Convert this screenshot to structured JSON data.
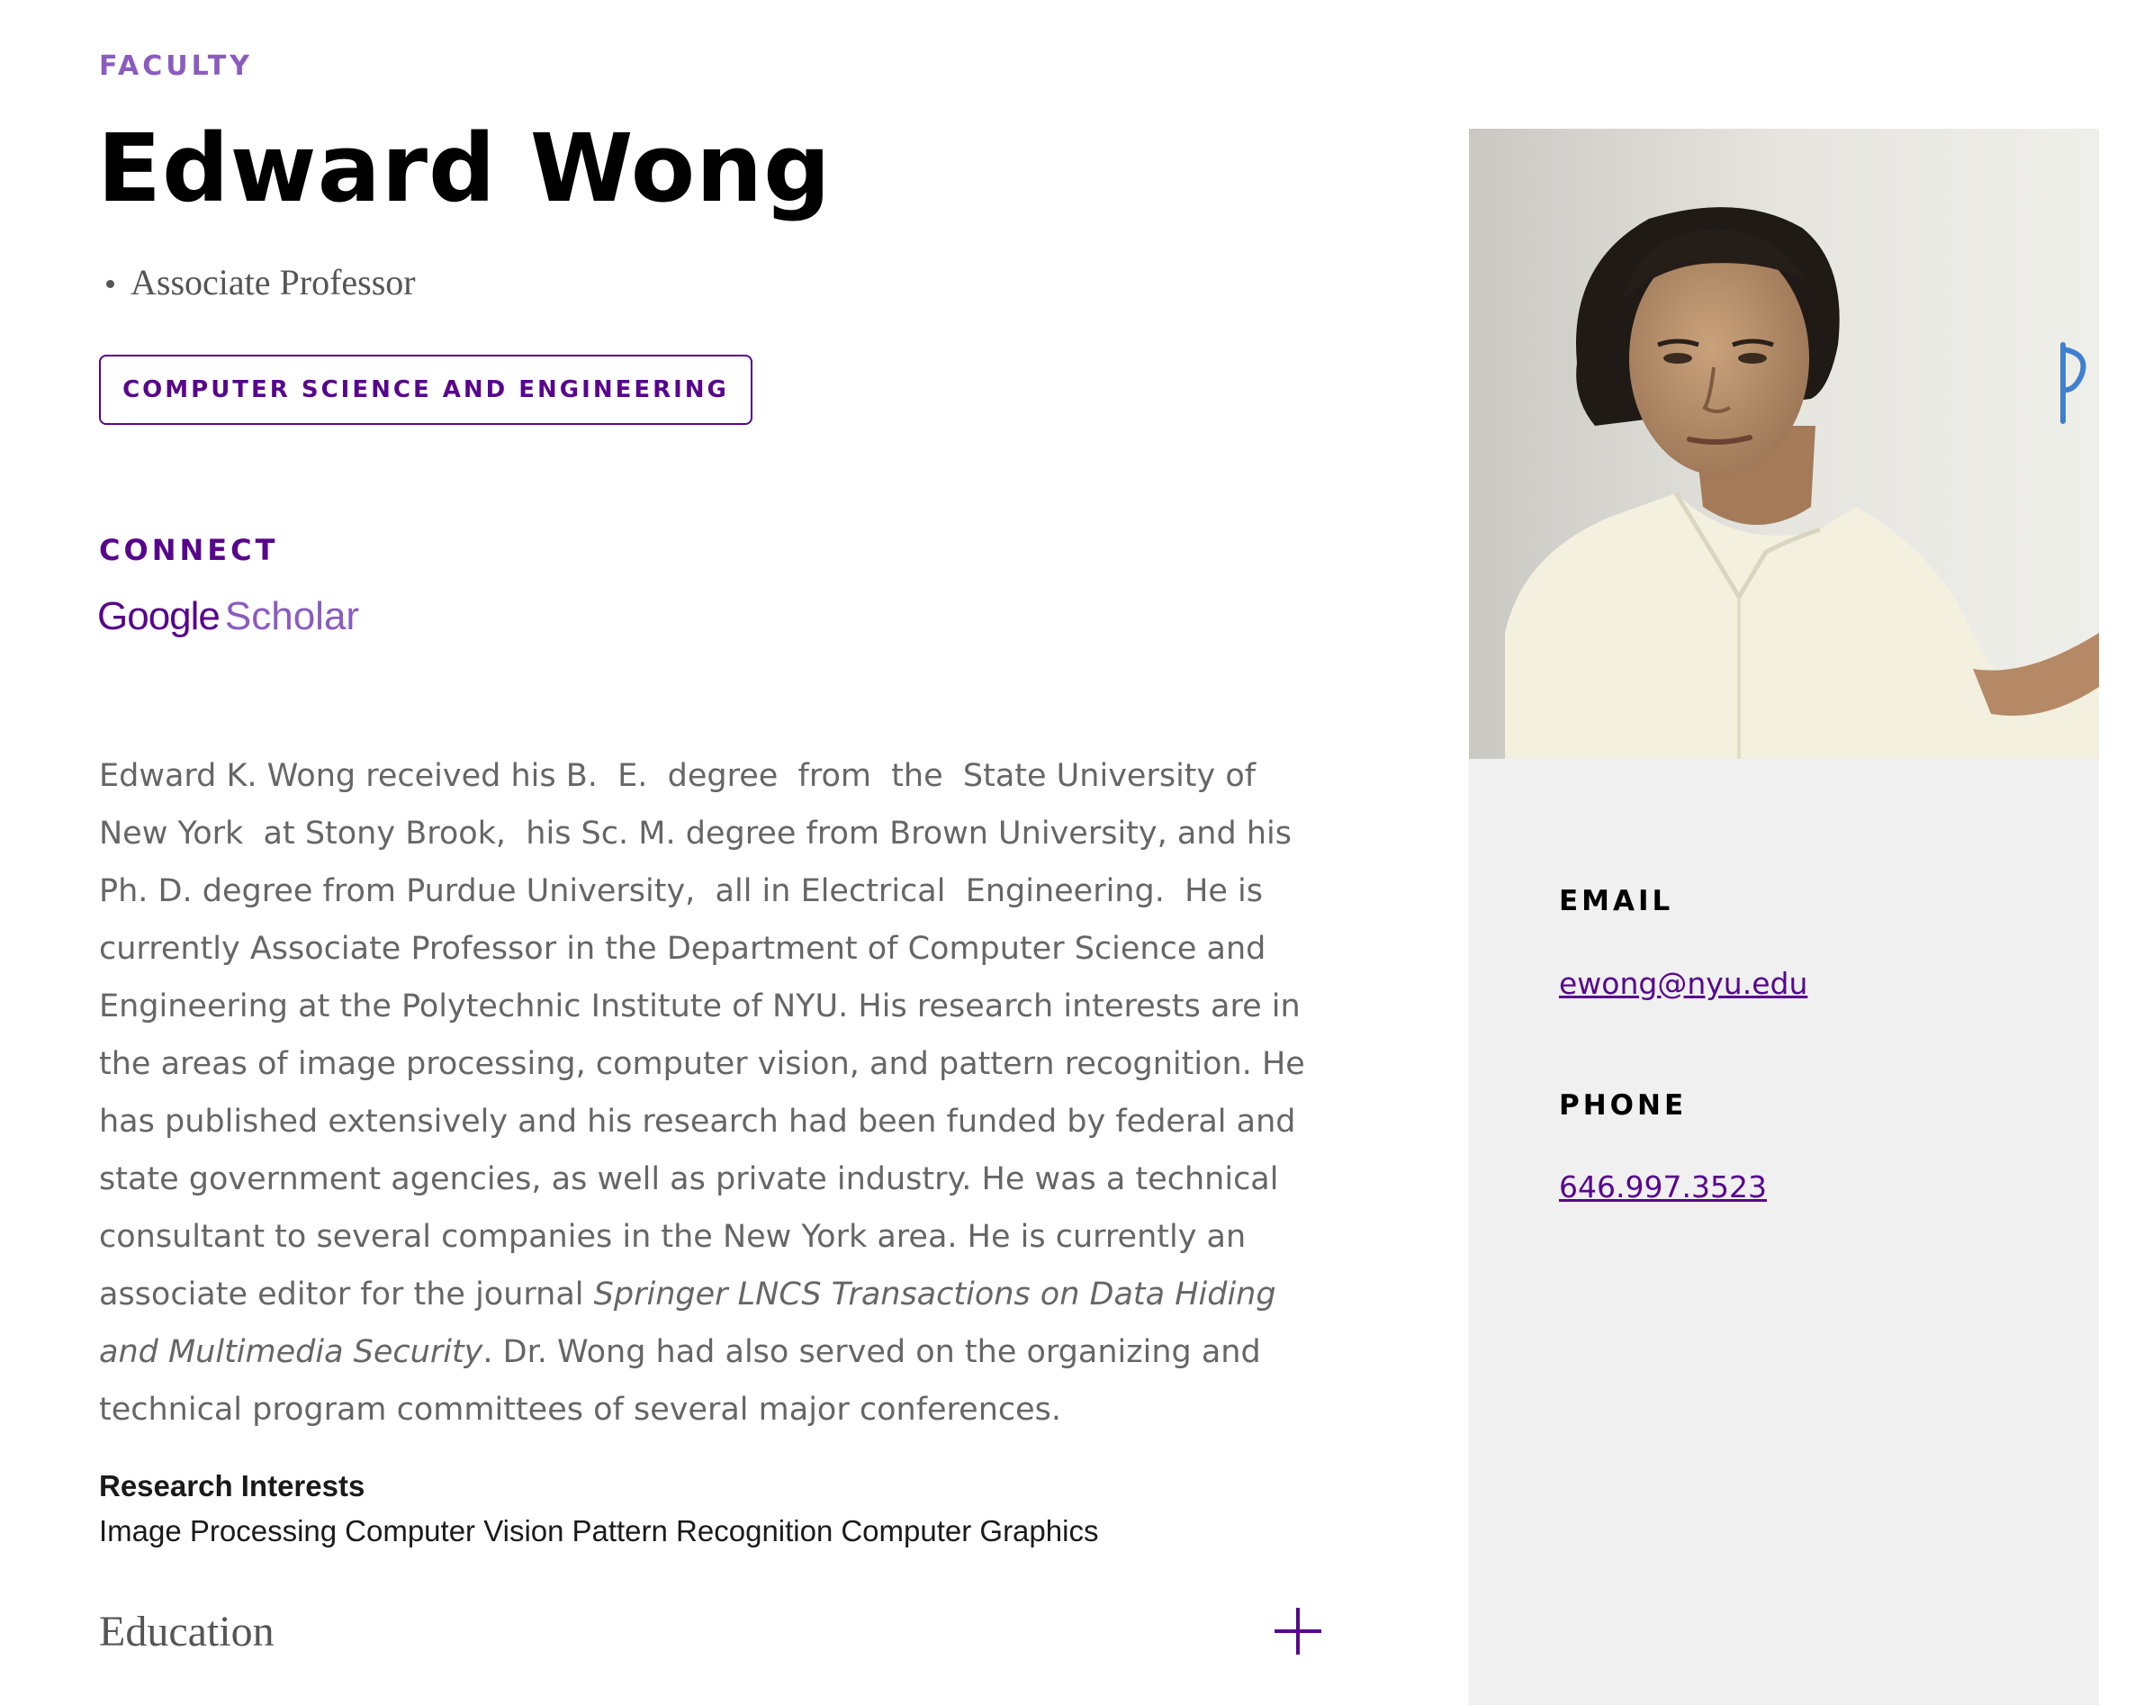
{
  "header": {
    "eyebrow": "FACULTY",
    "name": "Edward Wong",
    "titles": [
      "Associate Professor"
    ],
    "department_button": "COMPUTER SCIENCE AND ENGINEERING"
  },
  "connect": {
    "heading": "CONNECT",
    "links": [
      {
        "part1": "Google",
        "part2": "Scholar",
        "icon": "google-scholar-logo"
      }
    ]
  },
  "bio": {
    "lines": [
      [
        "Edward K. Wong received his B.  E.  degree  from  the  State University of"
      ],
      [
        "New York  at Stony Brook,  his Sc. M. degree from Brown University, and his"
      ],
      [
        "Ph. D. degree from Purdue University,  all in Electrical  Engineering.  He is"
      ],
      [
        "currently Associate Professor in the Department of Computer Science and"
      ],
      [
        "Engineering at the Polytechnic Institute of NYU. His research interests are in"
      ],
      [
        "the areas of image processing, computer vision, and pattern recognition. He"
      ],
      [
        "has published extensively and his research had been funded by federal and"
      ],
      [
        "state government agencies, as well as private industry. He was a technical"
      ],
      [
        "consultant to several companies in the New York area. He is currently an"
      ],
      [
        "associate editor for the journal ",
        "Springer LNCS Transactions on Data Hiding"
      ],
      [
        "and Multimedia Security",
        ". Dr. Wong had also served on the organizing and"
      ],
      [
        "technical program committees of several major conferences."
      ]
    ]
  },
  "research": {
    "heading": "Research Interests",
    "items": [
      "Image Processing",
      "Computer Vision",
      "Pattern Recognition",
      "Computer Graphics"
    ]
  },
  "education": {
    "label": "Education",
    "toggle_icon": "plus-icon"
  },
  "contact": {
    "email_label": "EMAIL",
    "email": "ewong@nyu.edu",
    "phone_label": "PHONE",
    "phone": "646.997.3523"
  },
  "colors": {
    "brand_purple": "#57068c",
    "light_purple": "#8a5cc0",
    "body_text": "#666666",
    "sidebar_bg": "#f0f0f0"
  }
}
